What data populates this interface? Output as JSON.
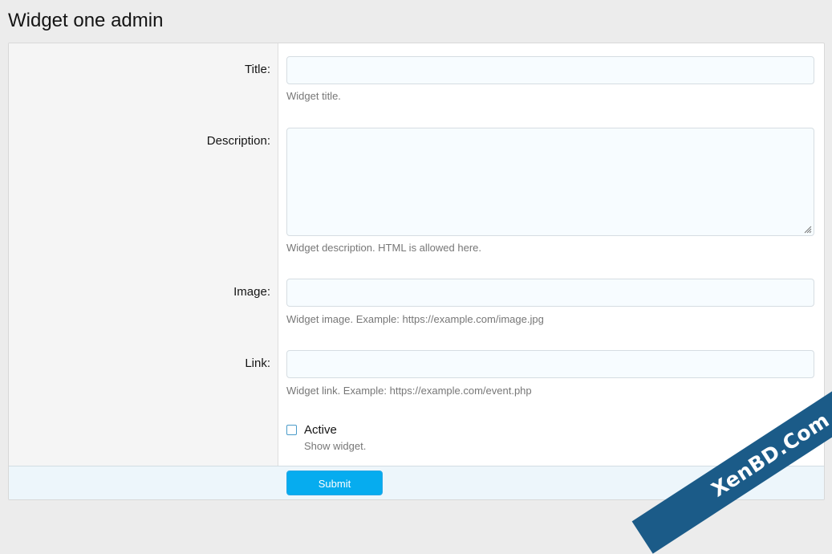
{
  "page": {
    "title": "Widget one admin"
  },
  "form": {
    "fields": [
      {
        "label": "Title:",
        "value": "",
        "hint": "Widget title."
      },
      {
        "label": "Description:",
        "value": "",
        "hint": "Widget description. HTML is allowed here."
      },
      {
        "label": "Image:",
        "value": "",
        "hint": "Widget image. Example: https://example.com/image.jpg"
      },
      {
        "label": "Link:",
        "value": "",
        "hint": "Widget link. Example: https://example.com/event.php"
      }
    ],
    "active": {
      "label": "Active",
      "checked": false,
      "hint": "Show widget."
    },
    "submit_label": "Submit"
  },
  "watermark": {
    "text": "XenBD.Com"
  }
}
